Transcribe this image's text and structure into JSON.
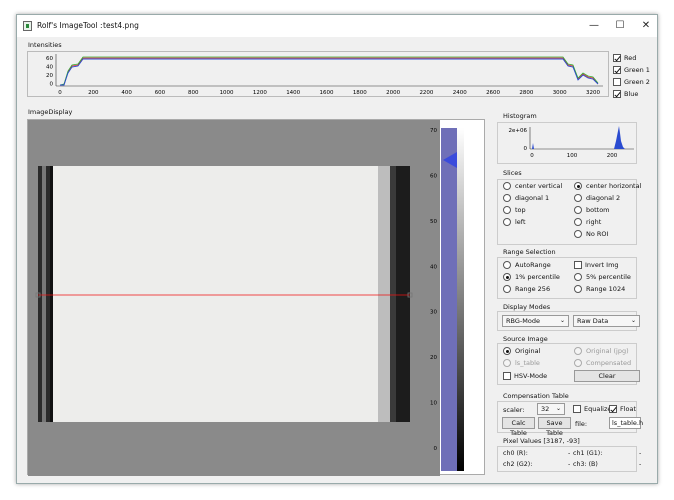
{
  "window": {
    "title": "Rolf's ImageTool :",
    "file": "test4.png",
    "min": "—",
    "max": "☐",
    "close": "✕"
  },
  "intensities": {
    "label": "Intensities",
    "yticks": [
      "60",
      "40",
      "20",
      "0"
    ],
    "xticks": [
      "0",
      "200",
      "400",
      "600",
      "800",
      "1000",
      "1200",
      "1400",
      "1600",
      "1800",
      "2000",
      "2200",
      "2400",
      "2600",
      "2800",
      "3000",
      "3200"
    ],
    "channels": [
      {
        "label": "Red",
        "checked": true,
        "color": "#d33"
      },
      {
        "label": "Green 1",
        "checked": true,
        "color": "#3a3"
      },
      {
        "label": "Green 2",
        "checked": false,
        "color": "#7c7"
      },
      {
        "label": "Blue",
        "checked": true,
        "color": "#2a4bd0"
      }
    ]
  },
  "image_display": {
    "label": "ImageDisplay",
    "colorbar_ticks": [
      "70",
      "60",
      "50",
      "40",
      "30",
      "20",
      "10",
      "0"
    ]
  },
  "histogram": {
    "label": "Histogram",
    "yticks": [
      "2e+06",
      "0"
    ],
    "xticks": [
      "0",
      "100",
      "200"
    ]
  },
  "slices": {
    "label": "Slices",
    "options": [
      {
        "label": "center vertical",
        "checked": false
      },
      {
        "label": "center horizontal",
        "checked": true
      },
      {
        "label": "diagonal 1",
        "checked": false
      },
      {
        "label": "diagonal 2",
        "checked": false
      },
      {
        "label": "top",
        "checked": false
      },
      {
        "label": "bottom",
        "checked": false
      },
      {
        "label": "left",
        "checked": false
      },
      {
        "label": "right",
        "checked": false
      },
      {
        "label": "No ROI",
        "checked": false
      }
    ]
  },
  "range_selection": {
    "label": "Range Selection",
    "autorange": "AutoRange",
    "invert": "Invert Img",
    "p1": "1% percentile",
    "p5": "5% percentile",
    "r256": "Range 256",
    "r1024": "Range 1024"
  },
  "display_modes": {
    "label": "Display Modes",
    "mode": "RBG-Mode",
    "data": "Raw Data"
  },
  "source_image": {
    "label": "Source Image",
    "original": "Original",
    "original_jpg": "Original (jpg)",
    "ls_table": "ls_table",
    "compensated": "Compensated",
    "hsv": "HSV-Mode",
    "clear": "Clear"
  },
  "compensation": {
    "label": "Compensation Table",
    "scaler_label": "scaler:",
    "scaler": "32",
    "equalize": "Equalize",
    "float": "Float",
    "calc": "Calc Table",
    "save": "Save Table",
    "file_label": "file:",
    "file": "ls_table.h"
  },
  "pixel_values": {
    "label": "Pixel Values [3187, -93]",
    "ch0_label": "ch0 (R):",
    "ch0": "-",
    "ch1_label": "ch1 (G1):",
    "ch1": "-",
    "ch2_label": "ch2 (G2):",
    "ch2": "-",
    "ch3_label": "ch3: (B)",
    "ch3": "-"
  }
}
